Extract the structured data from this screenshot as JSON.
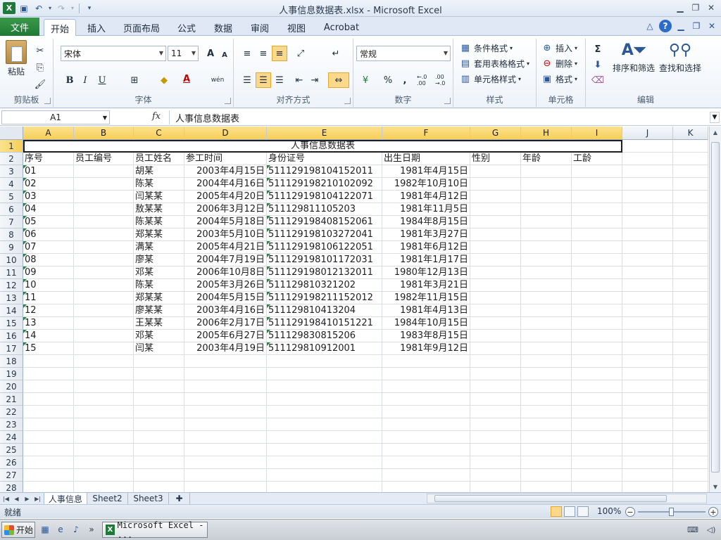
{
  "window": {
    "title": "人事信息数据表.xlsx  -  Microsoft Excel"
  },
  "ribbon_tabs": {
    "file": "文件",
    "tabs": [
      {
        "label": "开始"
      },
      {
        "label": "插入"
      },
      {
        "label": "页面布局"
      },
      {
        "label": "公式"
      },
      {
        "label": "数据"
      },
      {
        "label": "审阅"
      },
      {
        "label": "视图"
      },
      {
        "label": "Acrobat"
      }
    ]
  },
  "ribbon": {
    "clipboard": {
      "paste": "粘贴",
      "label": "剪贴板"
    },
    "font": {
      "name": "宋体",
      "size": "11",
      "label": "字体",
      "grow": "A",
      "shrink": "A",
      "bold": "B",
      "italic": "I",
      "underline": "U",
      "font_color_letter": "A",
      "phonetic": "wén"
    },
    "alignment": {
      "label": "对齐方式"
    },
    "number": {
      "format": "常规",
      "percent": "%",
      "comma": ",",
      "inc_decimal": "←.0 .00",
      "dec_decimal": ".00 →.0",
      "label": "数字"
    },
    "styles": {
      "conditional": "条件格式",
      "table": "套用表格格式",
      "cell": "单元格样式",
      "label": "样式"
    },
    "cells": {
      "insert": "插入",
      "delete": "删除",
      "format": "格式",
      "label": "单元格"
    },
    "editing": {
      "sort": "排序和筛选",
      "find": "查找和选择",
      "sigma": "Σ",
      "label": "编辑"
    }
  },
  "formula_bar": {
    "name_box": "A1",
    "fx": "fx",
    "content": "人事信息数据表"
  },
  "columns": [
    "A",
    "B",
    "C",
    "D",
    "E",
    "F",
    "G",
    "H",
    "I",
    "J",
    "K"
  ],
  "rows": [
    "1",
    "2",
    "3",
    "4",
    "5",
    "6",
    "7",
    "8",
    "9",
    "10",
    "11",
    "12",
    "13",
    "14",
    "15",
    "16",
    "17",
    "18",
    "19",
    "20",
    "21",
    "22",
    "23",
    "24",
    "25",
    "26",
    "27",
    "28"
  ],
  "sheet": {
    "title": "人事信息数据表",
    "headers": [
      "序号",
      "员工编号",
      "员工姓名",
      "参工时间",
      "身份证号",
      "出生日期",
      "性别",
      "年龄",
      "工龄"
    ],
    "records": [
      {
        "seq": "01",
        "name": "胡某",
        "start": "2003年4月15日",
        "id": "511129198104152011",
        "birth": "1981年4月15日"
      },
      {
        "seq": "02",
        "name": "陈某",
        "start": "2004年4月16日",
        "id": "511129198210102092",
        "birth": "1982年10月10日"
      },
      {
        "seq": "03",
        "name": "闫某某",
        "start": "2005年4月20日",
        "id": "511129198104122071",
        "birth": "1981年4月12日"
      },
      {
        "seq": "04",
        "name": "敖某某",
        "start": "2006年3月12日",
        "id": "511129811105203",
        "birth": "1981年11月5日"
      },
      {
        "seq": "05",
        "name": "陈某某",
        "start": "2004年5月18日",
        "id": "511129198408152061",
        "birth": "1984年8月15日"
      },
      {
        "seq": "06",
        "name": "郑某某",
        "start": "2003年5月10日",
        "id": "511129198103272041",
        "birth": "1981年3月27日"
      },
      {
        "seq": "07",
        "name": "满某",
        "start": "2005年4月21日",
        "id": "511129198106122051",
        "birth": "1981年6月12日"
      },
      {
        "seq": "08",
        "name": "廖某",
        "start": "2004年7月19日",
        "id": "511129198101172031",
        "birth": "1981年1月17日"
      },
      {
        "seq": "09",
        "name": "邓某",
        "start": "2006年10月8日",
        "id": "511129198012132011",
        "birth": "1980年12月13日"
      },
      {
        "seq": "10",
        "name": "陈某",
        "start": "2005年3月26日",
        "id": "511129810321202",
        "birth": "1981年3月21日"
      },
      {
        "seq": "11",
        "name": "郑某某",
        "start": "2004年5月15日",
        "id": "511129198211152012",
        "birth": "1982年11月15日"
      },
      {
        "seq": "12",
        "name": "廖某某",
        "start": "2003年4月16日",
        "id": "511129810413204",
        "birth": "1981年4月13日"
      },
      {
        "seq": "13",
        "name": "王某某",
        "start": "2006年2月17日",
        "id": "511129198410151221",
        "birth": "1984年10月15日"
      },
      {
        "seq": "14",
        "name": "邓某",
        "start": "2005年6月27日",
        "id": "511129830815206",
        "birth": "1983年8月15日"
      },
      {
        "seq": "15",
        "name": "闫某",
        "start": "2003年4月19日",
        "id": "511129810912001",
        "birth": "1981年9月12日"
      }
    ]
  },
  "sheet_tabs": [
    "人事信息",
    "Sheet2",
    "Sheet3"
  ],
  "status": {
    "ready": "就绪",
    "zoom": "100%",
    "zoom_level_percent": 100
  },
  "taskbar": {
    "start": "开始",
    "item": "Microsoft Excel - ..."
  }
}
